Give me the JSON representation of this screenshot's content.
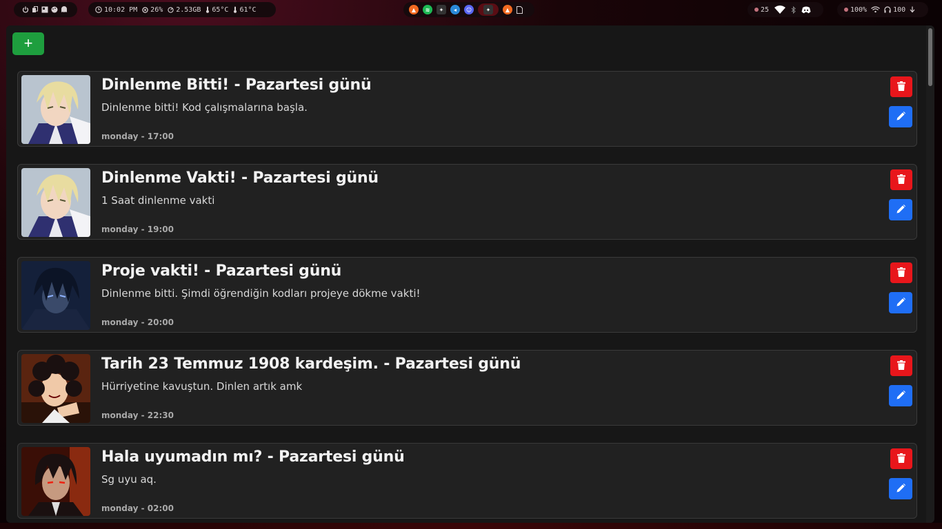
{
  "statusbar": {
    "clock": "10:02 PM",
    "cpu": "26%",
    "memory": "2.53GB",
    "temp1": "65°C",
    "temp2": "61°C",
    "updates": "25",
    "battery": "100%",
    "volume": "100"
  },
  "tray_apps": [
    "brave-icon",
    "spotify-icon",
    "terminal-icon",
    "vscode-icon",
    "discord-icon",
    "active-window-icon",
    "brave-icon-2",
    "file-icon"
  ],
  "colors": {
    "add": "#1e9e3e",
    "delete": "#e8161b",
    "edit": "#1f6ef5",
    "card": "#212121",
    "panel": "#171717"
  },
  "toolbar": {
    "add_label": "+"
  },
  "reminders": [
    {
      "title": "Dinlenme Bitti! - Pazartesi günü",
      "description": "Dinlenme bitti! Kod çalışmalarına başla.",
      "schedule": "monday - 17:00",
      "avatar": "anime-blonde-avatar"
    },
    {
      "title": "Dinlenme Vakti! - Pazartesi günü",
      "description": "1 Saat dinlenme vakti",
      "schedule": "monday - 19:00",
      "avatar": "anime-blonde-avatar"
    },
    {
      "title": "Proje vakti! - Pazartesi günü",
      "description": "Dinlenme bitti. Şimdi öğrendiğin kodları projeye dökme vakti!",
      "schedule": "monday - 20:00",
      "avatar": "anime-dark-hair-avatar"
    },
    {
      "title": "Tarih 23 Temmuz 1908 kardeşim. - Pazartesi günü",
      "description": "Hürriyetine kavuştun. Dinlen artık amk",
      "schedule": "monday - 22:30",
      "avatar": "anime-curly-hair-avatar"
    },
    {
      "title": "Hala uyumadın mı? - Pazartesi günü",
      "description": "Sg uyu aq.",
      "schedule": "monday - 02:00",
      "avatar": "anime-red-eyes-avatar"
    }
  ]
}
